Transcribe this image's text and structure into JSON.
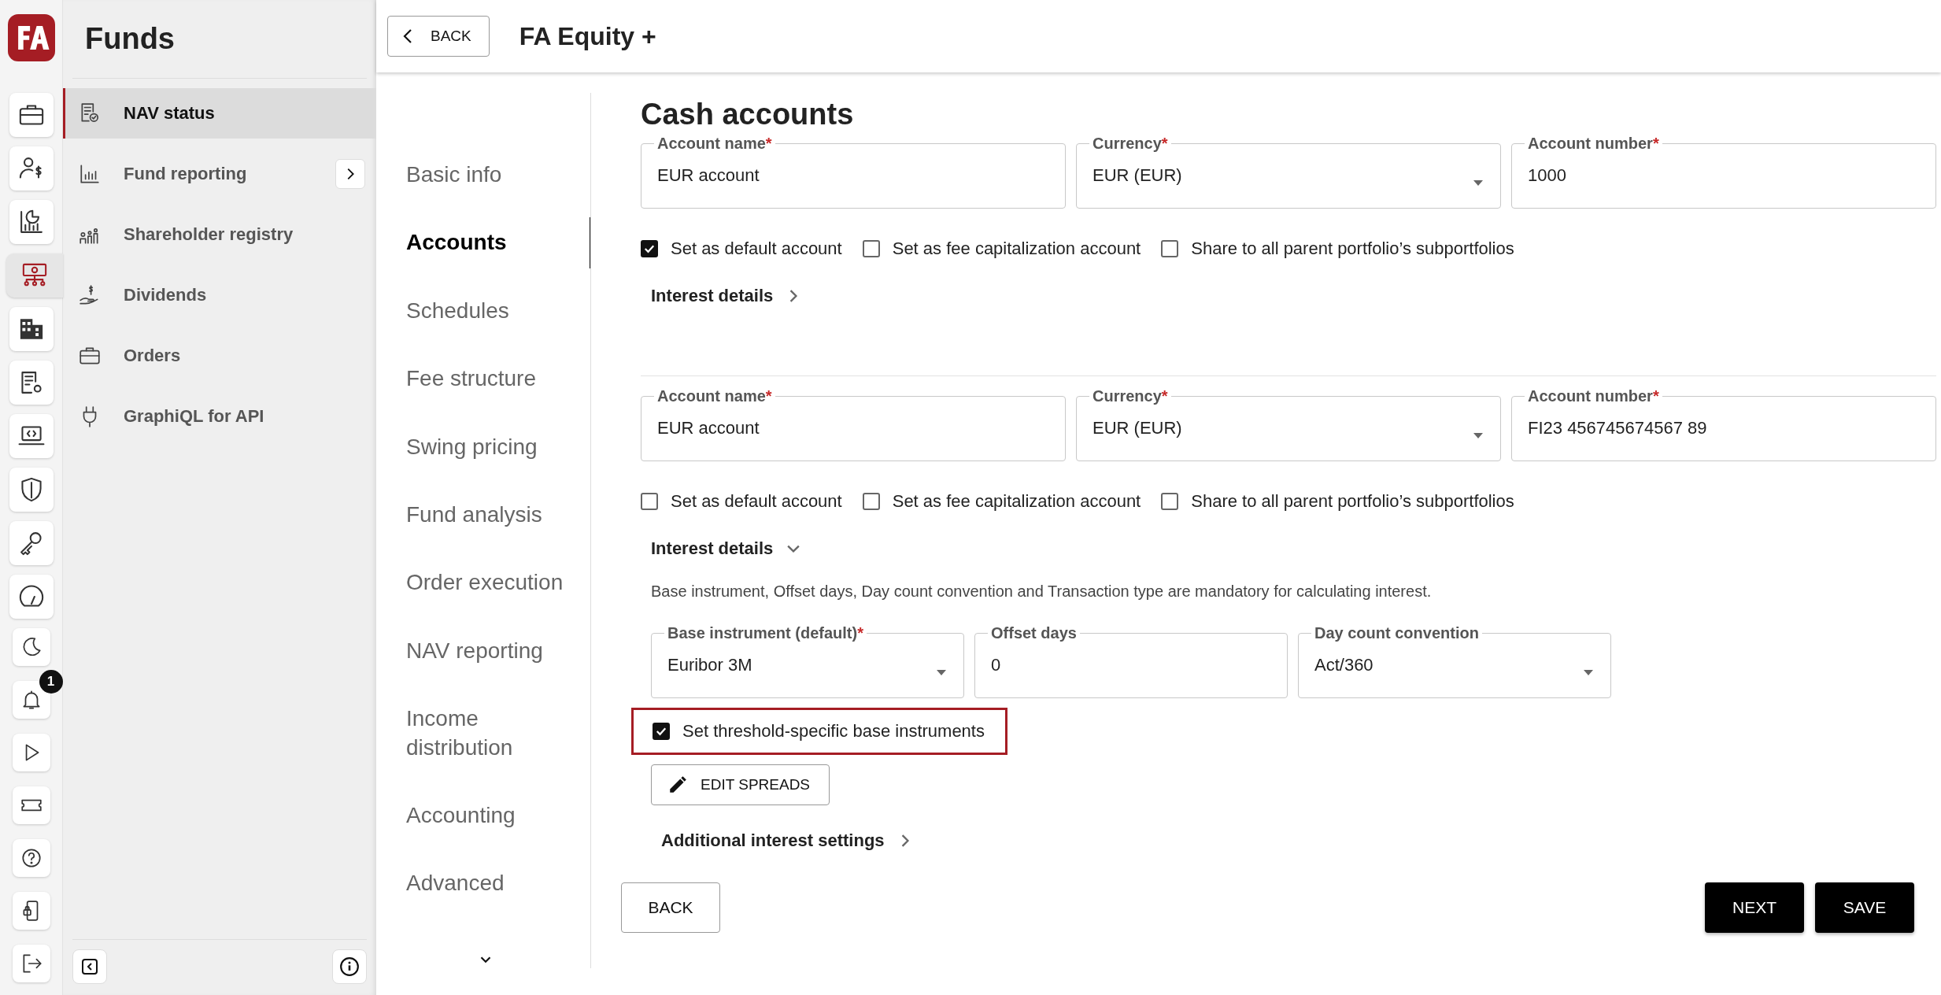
{
  "rail": {
    "items": [
      {
        "selected": false
      },
      {
        "selected": false
      },
      {
        "selected": false
      },
      {
        "selected": true
      },
      {
        "selected": false
      },
      {
        "selected": false
      },
      {
        "selected": false
      },
      {
        "selected": false
      },
      {
        "selected": false
      },
      {
        "selected": false
      },
      {
        "selected": false
      },
      {
        "selected": false,
        "badge": "1"
      },
      {
        "selected": false
      },
      {
        "selected": false
      },
      {
        "selected": false
      },
      {
        "selected": false
      },
      {
        "selected": false
      }
    ]
  },
  "sidebar": {
    "title": "Funds",
    "items": [
      {
        "label": "NAV status",
        "selected": true,
        "expandable": false
      },
      {
        "label": "Fund reporting",
        "selected": false,
        "expandable": true
      },
      {
        "label": "Shareholder registry",
        "selected": false,
        "expandable": false
      },
      {
        "label": "Dividends",
        "selected": false,
        "expandable": false
      },
      {
        "label": "Orders",
        "selected": false,
        "expandable": false
      },
      {
        "label": "GraphiQL for API",
        "selected": false,
        "expandable": false
      }
    ]
  },
  "header": {
    "back": "BACK",
    "title": "FA Equity +"
  },
  "nav": {
    "items": [
      {
        "label": "Basic info",
        "selected": false
      },
      {
        "label": "Accounts",
        "selected": true
      },
      {
        "label": "Schedules",
        "selected": false
      },
      {
        "label": "Fee structure",
        "selected": false
      },
      {
        "label": "Swing pricing",
        "selected": false
      },
      {
        "label": "Fund analysis",
        "selected": false
      },
      {
        "label": "Order execution",
        "selected": false
      },
      {
        "label": "NAV reporting",
        "selected": false
      },
      {
        "label": "Income distribution",
        "selected": false
      },
      {
        "label": "Accounting",
        "selected": false
      },
      {
        "label": "Advanced",
        "selected": false
      }
    ]
  },
  "section_title": "Cash accounts",
  "accounts": [
    {
      "fields": [
        {
          "kind": "text",
          "label": "Account name",
          "required_mark": "*",
          "value": "EUR account"
        },
        {
          "kind": "select",
          "label": "Currency",
          "required_mark": "*",
          "value": "EUR (EUR)"
        },
        {
          "kind": "text",
          "label": "Account number",
          "required_mark": "*",
          "value": "1000"
        }
      ],
      "checkboxes": [
        {
          "label": "Set as default account",
          "checked": true
        },
        {
          "label": "Set as fee capitalization account",
          "checked": false
        },
        {
          "label": "Share to all parent portfolio’s subportfolios",
          "checked": false
        }
      ],
      "interest": {
        "label": "Interest details",
        "expanded": false
      }
    },
    {
      "fields": [
        {
          "kind": "text",
          "label": "Account name",
          "required_mark": "*",
          "value": "EUR account"
        },
        {
          "kind": "select",
          "label": "Currency",
          "required_mark": "*",
          "value": "EUR (EUR)"
        },
        {
          "kind": "text",
          "label": "Account number",
          "required_mark": "*",
          "value": "FI23 456745674567 89"
        }
      ],
      "checkboxes": [
        {
          "label": "Set as default account",
          "checked": false
        },
        {
          "label": "Set as fee capitalization account",
          "checked": false
        },
        {
          "label": "Share to all parent portfolio’s subportfolios",
          "checked": false
        }
      ],
      "interest": {
        "label": "Interest details",
        "expanded": true,
        "note": "Base instrument, Offset days, Day count convention and Transaction type are mandatory for calculating interest.",
        "fields": [
          {
            "kind": "select",
            "label": "Base instrument (default)",
            "required_mark": "*",
            "value": "Euribor 3M"
          },
          {
            "kind": "text",
            "label": "Offset days",
            "value": "0"
          },
          {
            "kind": "select",
            "label": "Day count convention",
            "value": "Act/360"
          }
        ],
        "threshold": {
          "label": "Set threshold-specific base instruments",
          "checked": true,
          "highlighted": true
        },
        "edit_button": "EDIT SPREADS",
        "additional": {
          "label": "Additional interest settings",
          "expanded": false
        }
      }
    }
  ],
  "footer": {
    "back": "BACK",
    "next": "NEXT",
    "save": "SAVE"
  }
}
